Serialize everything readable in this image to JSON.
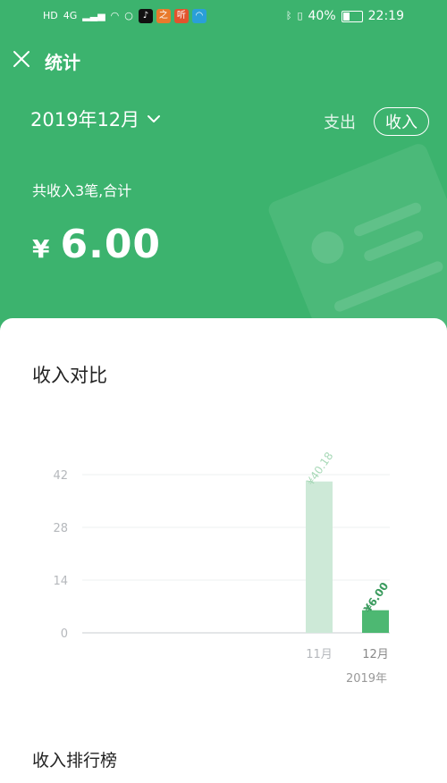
{
  "status_bar": {
    "network_labels": [
      "HD",
      "4G"
    ],
    "battery": "40%",
    "time": "22:19",
    "battery_level": 0.4,
    "apps": [
      {
        "icon": "tiktok-icon",
        "color": "#111111",
        "glyph": "♪"
      },
      {
        "icon": "app-orange-icon",
        "color": "#e87a2c",
        "glyph": "之"
      },
      {
        "icon": "listen-app-icon",
        "color": "#e2532d",
        "glyph": "听"
      },
      {
        "icon": "blue-app-icon",
        "color": "#2a9fd8",
        "glyph": "◠"
      }
    ]
  },
  "header": {
    "title": "统计",
    "month": "2019年12月",
    "tabs": {
      "expense": "支出",
      "income": "收入"
    },
    "summary": "共收入3笔,合计",
    "currency": "¥",
    "total": "6.00"
  },
  "main": {
    "comparison_title": "收入对比",
    "ranking_title": "收入排行榜"
  },
  "chart_data": {
    "type": "bar",
    "categories": [
      "11月",
      "12月"
    ],
    "values": [
      40.18,
      6.0
    ],
    "data_labels": [
      "¥40.18",
      "¥6.00"
    ],
    "yticks": [
      0,
      14,
      28,
      42
    ],
    "ylim": [
      0,
      42
    ],
    "year_label": "2019年",
    "colors": {
      "past": "#cde9d7",
      "current": "#4db872",
      "label_past": "#a6d8b6",
      "label_current": "#3a9b5e"
    },
    "grid": true
  },
  "theme": {
    "accent": "#3cb36e"
  }
}
